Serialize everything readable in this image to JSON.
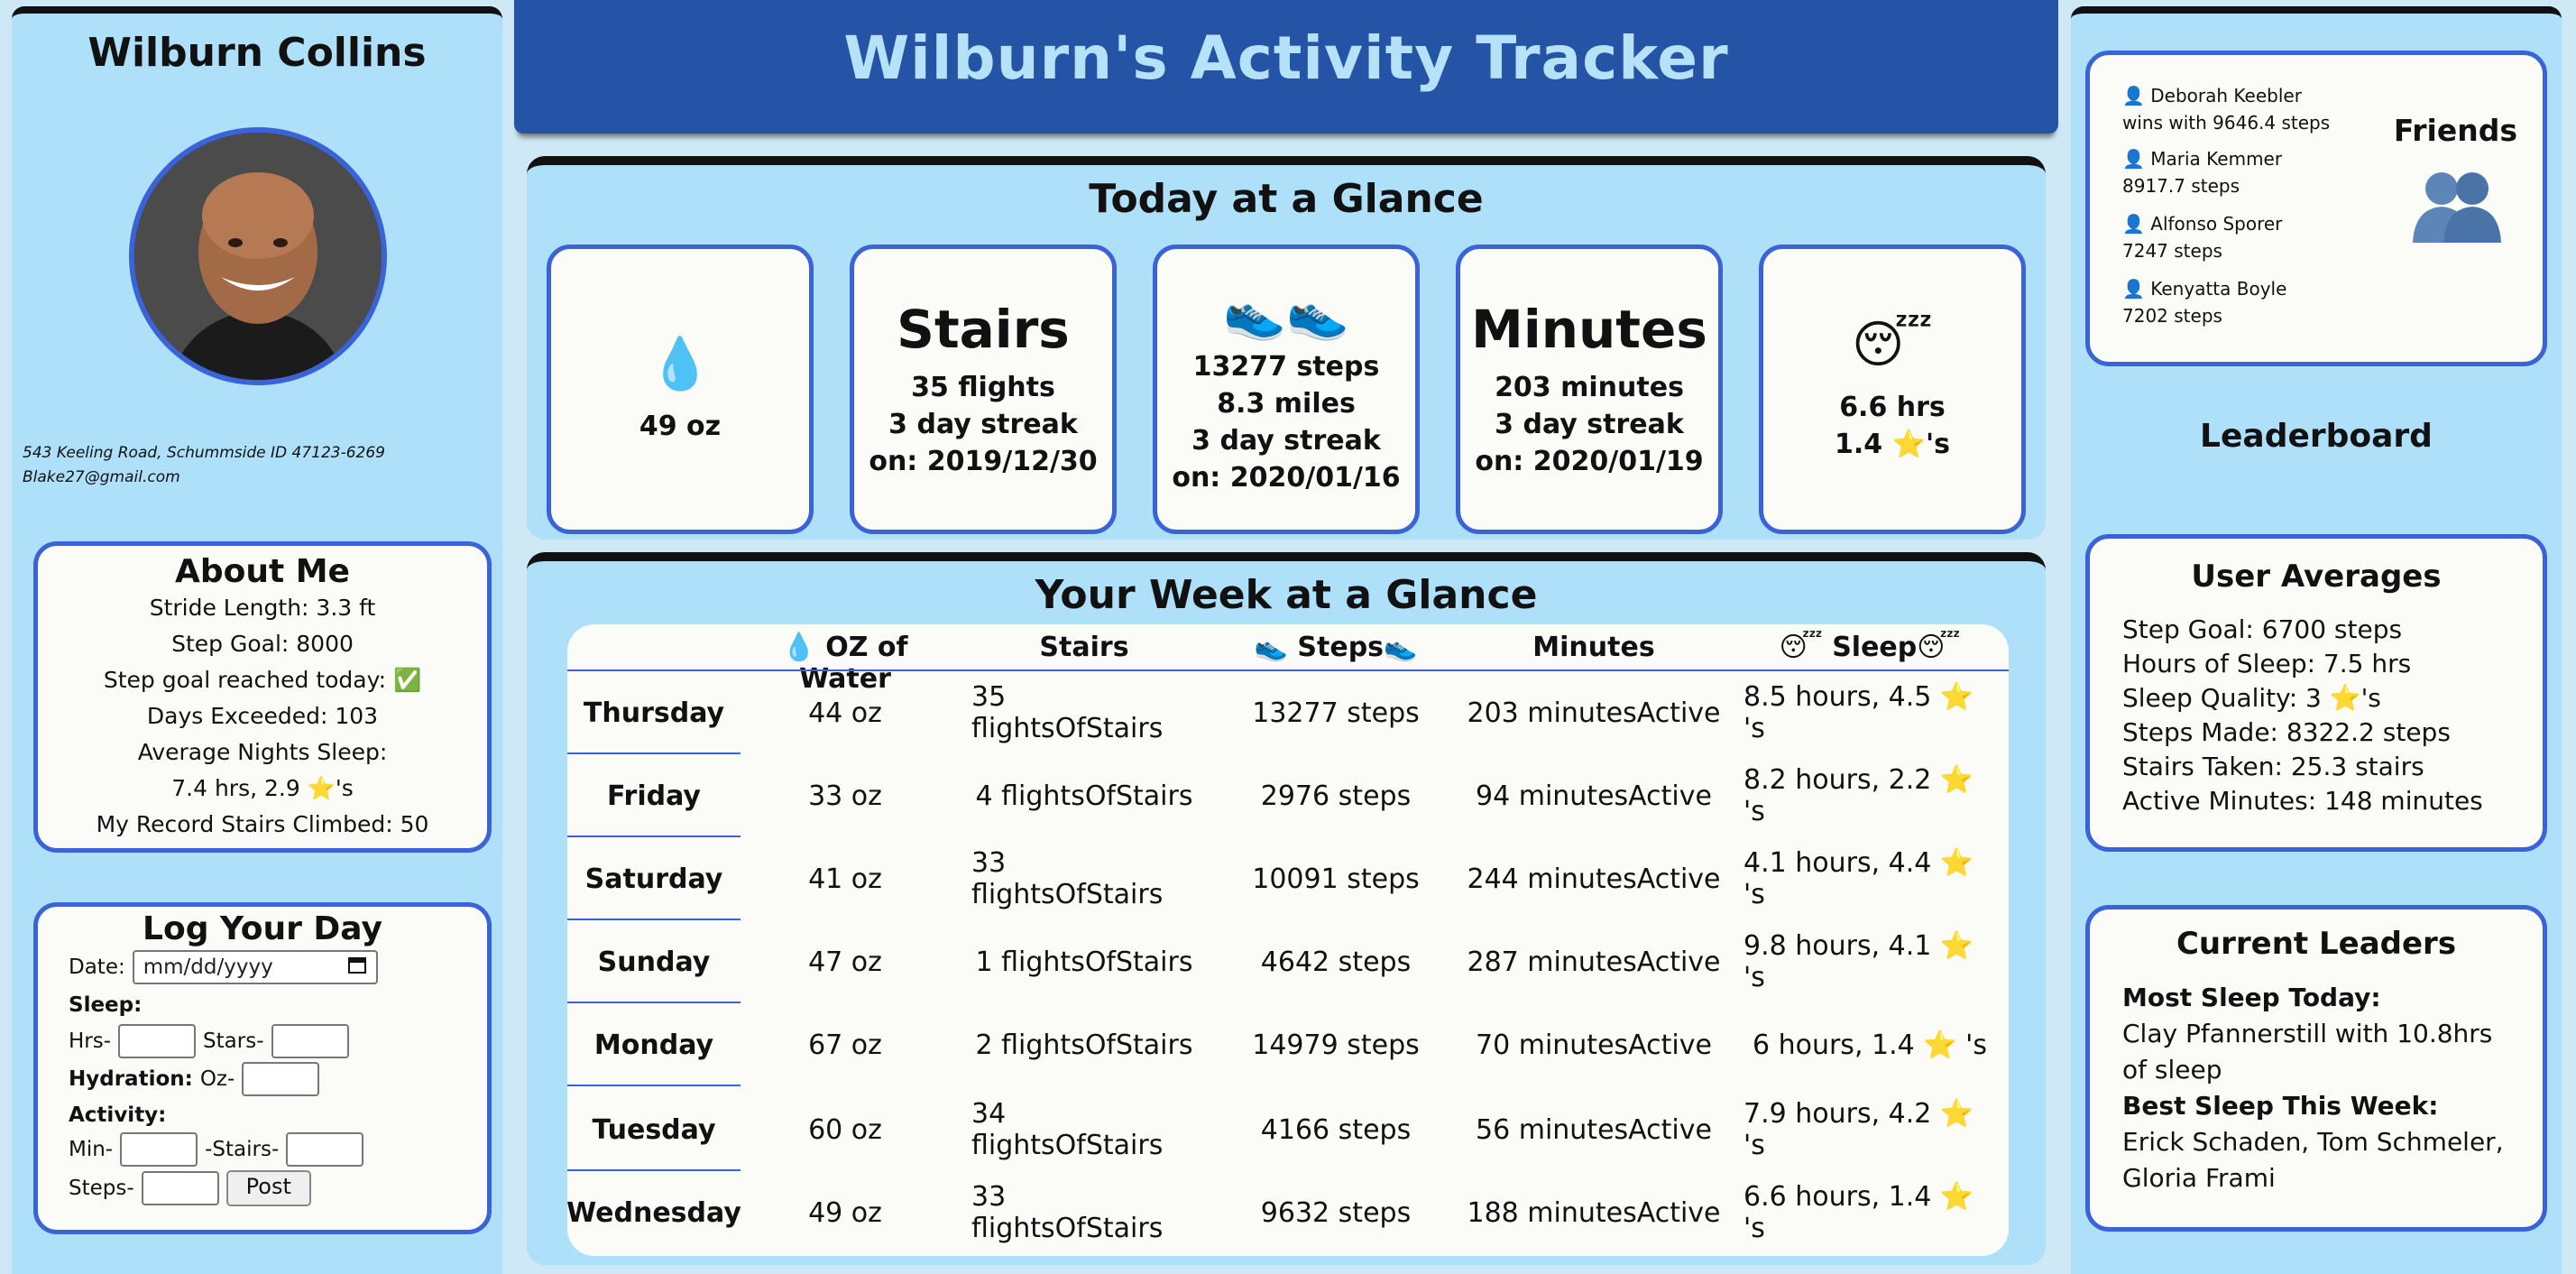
{
  "user": {
    "name": "Wilburn Collins",
    "address": "543 Keeling Road, Schummside ID 47123-6269",
    "email": "Blake27@gmail.com"
  },
  "about": {
    "title": "About Me",
    "lines": [
      "Stride Length: 3.3 ft",
      "Step Goal: 8000",
      "Step goal reached today: ✅",
      "Days Exceeded: 103",
      "Average Nights Sleep:",
      "7.4 hrs, 2.9 ⭐'s",
      "My Record Stairs Climbed: 50"
    ]
  },
  "log": {
    "title": "Log Your Day",
    "date_label": "Date:",
    "date_placeholder": "mm/dd/yyyy",
    "sleep_label": "Sleep:",
    "hrs_label": "Hrs-",
    "stars_label": "Stars-",
    "hydration_label": "Hydration:",
    "oz_label": "Oz-",
    "activity_label": "Activity:",
    "min_label": "Min-",
    "stairs_label": "-Stairs-",
    "steps_label": "Steps-",
    "post_label": "Post"
  },
  "header": {
    "title": "Wilburn's Activity Tracker"
  },
  "today": {
    "title": "Today at a Glance",
    "water": {
      "icon": "💧",
      "line1": "49 oz"
    },
    "stairs": {
      "title": "Stairs",
      "line1": "35 flights",
      "line2": "3 day streak",
      "line3": "on: 2019/12/30"
    },
    "steps": {
      "icon": "👟👟",
      "line1": "13277 steps",
      "line2": "8.3 miles",
      "line3": "3 day streak",
      "line4": "on: 2020/01/16"
    },
    "minutes": {
      "title": "Minutes",
      "line1": "203 minutes",
      "line2": "3 day streak",
      "line3": "on: 2020/01/19"
    },
    "sleep": {
      "icon": "😴",
      "line1": "6.6 hrs",
      "line2": "1.4 ⭐'s"
    }
  },
  "week": {
    "title": "Your Week at a Glance",
    "headers": [
      "💧 OZ of Water",
      "Stairs",
      "👟 Steps👟",
      "Minutes",
      "😴 Sleep😴"
    ],
    "rows": [
      [
        "Thursday",
        "44 oz",
        "35 flightsOfStairs",
        "13277 steps",
        "203 minutesActive",
        "8.5 hours, 4.5 ⭐ 's"
      ],
      [
        "Friday",
        "33 oz",
        "4 flightsOfStairs",
        "2976 steps",
        "94 minutesActive",
        "8.2 hours, 2.2 ⭐ 's"
      ],
      [
        "Saturday",
        "41 oz",
        "33 flightsOfStairs",
        "10091 steps",
        "244 minutesActive",
        "4.1 hours, 4.4 ⭐ 's"
      ],
      [
        "Sunday",
        "47 oz",
        "1 flightsOfStairs",
        "4642 steps",
        "287 minutesActive",
        "9.8 hours, 4.1 ⭐ 's"
      ],
      [
        "Monday",
        "67 oz",
        "2 flightsOfStairs",
        "14979 steps",
        "70 minutesActive",
        "6 hours, 1.4 ⭐ 's"
      ],
      [
        "Tuesday",
        "60 oz",
        "34 flightsOfStairs",
        "4166 steps",
        "56 minutesActive",
        "7.9 hours, 4.2 ⭐ 's"
      ],
      [
        "Wednesday",
        "49 oz",
        "33 flightsOfStairs",
        "9632 steps",
        "188 minutesActive",
        "6.6 hours, 1.4 ⭐ 's"
      ]
    ]
  },
  "friends": {
    "title": "Friends",
    "items": [
      {
        "name": "👤 Deborah Keebler",
        "detail": "wins with 9646.4 steps"
      },
      {
        "name": "👤 Maria Kemmer",
        "detail": "8917.7 steps"
      },
      {
        "name": "👤 Alfonso Sporer",
        "detail": "7247 steps"
      },
      {
        "name": "👤 Kenyatta Boyle",
        "detail": "7202 steps"
      }
    ]
  },
  "leaderboard": {
    "title": "Leaderboard"
  },
  "averages": {
    "title": "User Averages",
    "lines": [
      "Step Goal: 6700 steps",
      "Hours of Sleep: 7.5 hrs",
      "Sleep Quality: 3 ⭐'s",
      "Steps Made: 8322.2 steps",
      "Stairs Taken: 25.3 stairs",
      "Active Minutes: 148 minutes"
    ]
  },
  "leaders": {
    "title": "Current Leaders",
    "sleep_today_label": "Most Sleep Today:",
    "sleep_today_value": "Clay Pfannerstill with 10.8hrs of sleep",
    "sleep_week_label": "Best Sleep This Week:",
    "sleep_week_value": "Erick Schaden, Tom Schmeler, Gloria Frami"
  },
  "colors": {
    "header_bg": "#2553a5",
    "panel_bg": "#aee0fa",
    "card_border": "#3b63d8"
  }
}
